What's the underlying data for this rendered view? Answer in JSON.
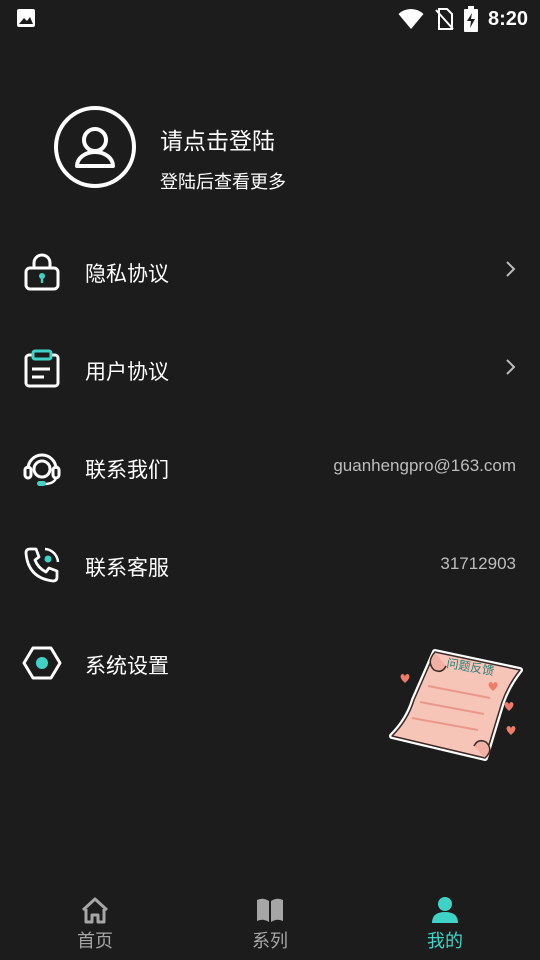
{
  "status": {
    "time": "8:20"
  },
  "profile": {
    "title": "请点击登陆",
    "subtitle": "登陆后查看更多"
  },
  "menu": [
    {
      "label": "隐私协议",
      "value": ""
    },
    {
      "label": "用户协议",
      "value": ""
    },
    {
      "label": "联系我们",
      "value": "guanhengpro@163.com"
    },
    {
      "label": "联系客服",
      "value": "31712903"
    },
    {
      "label": "系统设置",
      "value": ""
    }
  ],
  "feedback": {
    "label": "问题反馈"
  },
  "tabs": [
    {
      "label": "首页"
    },
    {
      "label": "系列"
    },
    {
      "label": "我的"
    }
  ],
  "colors": {
    "accent": "#3fd3c8",
    "background": "#1c1c1c",
    "inactive": "#a6a6a6",
    "feedback_paper": "#f7c4b8",
    "heart": "#ef7b6a"
  }
}
